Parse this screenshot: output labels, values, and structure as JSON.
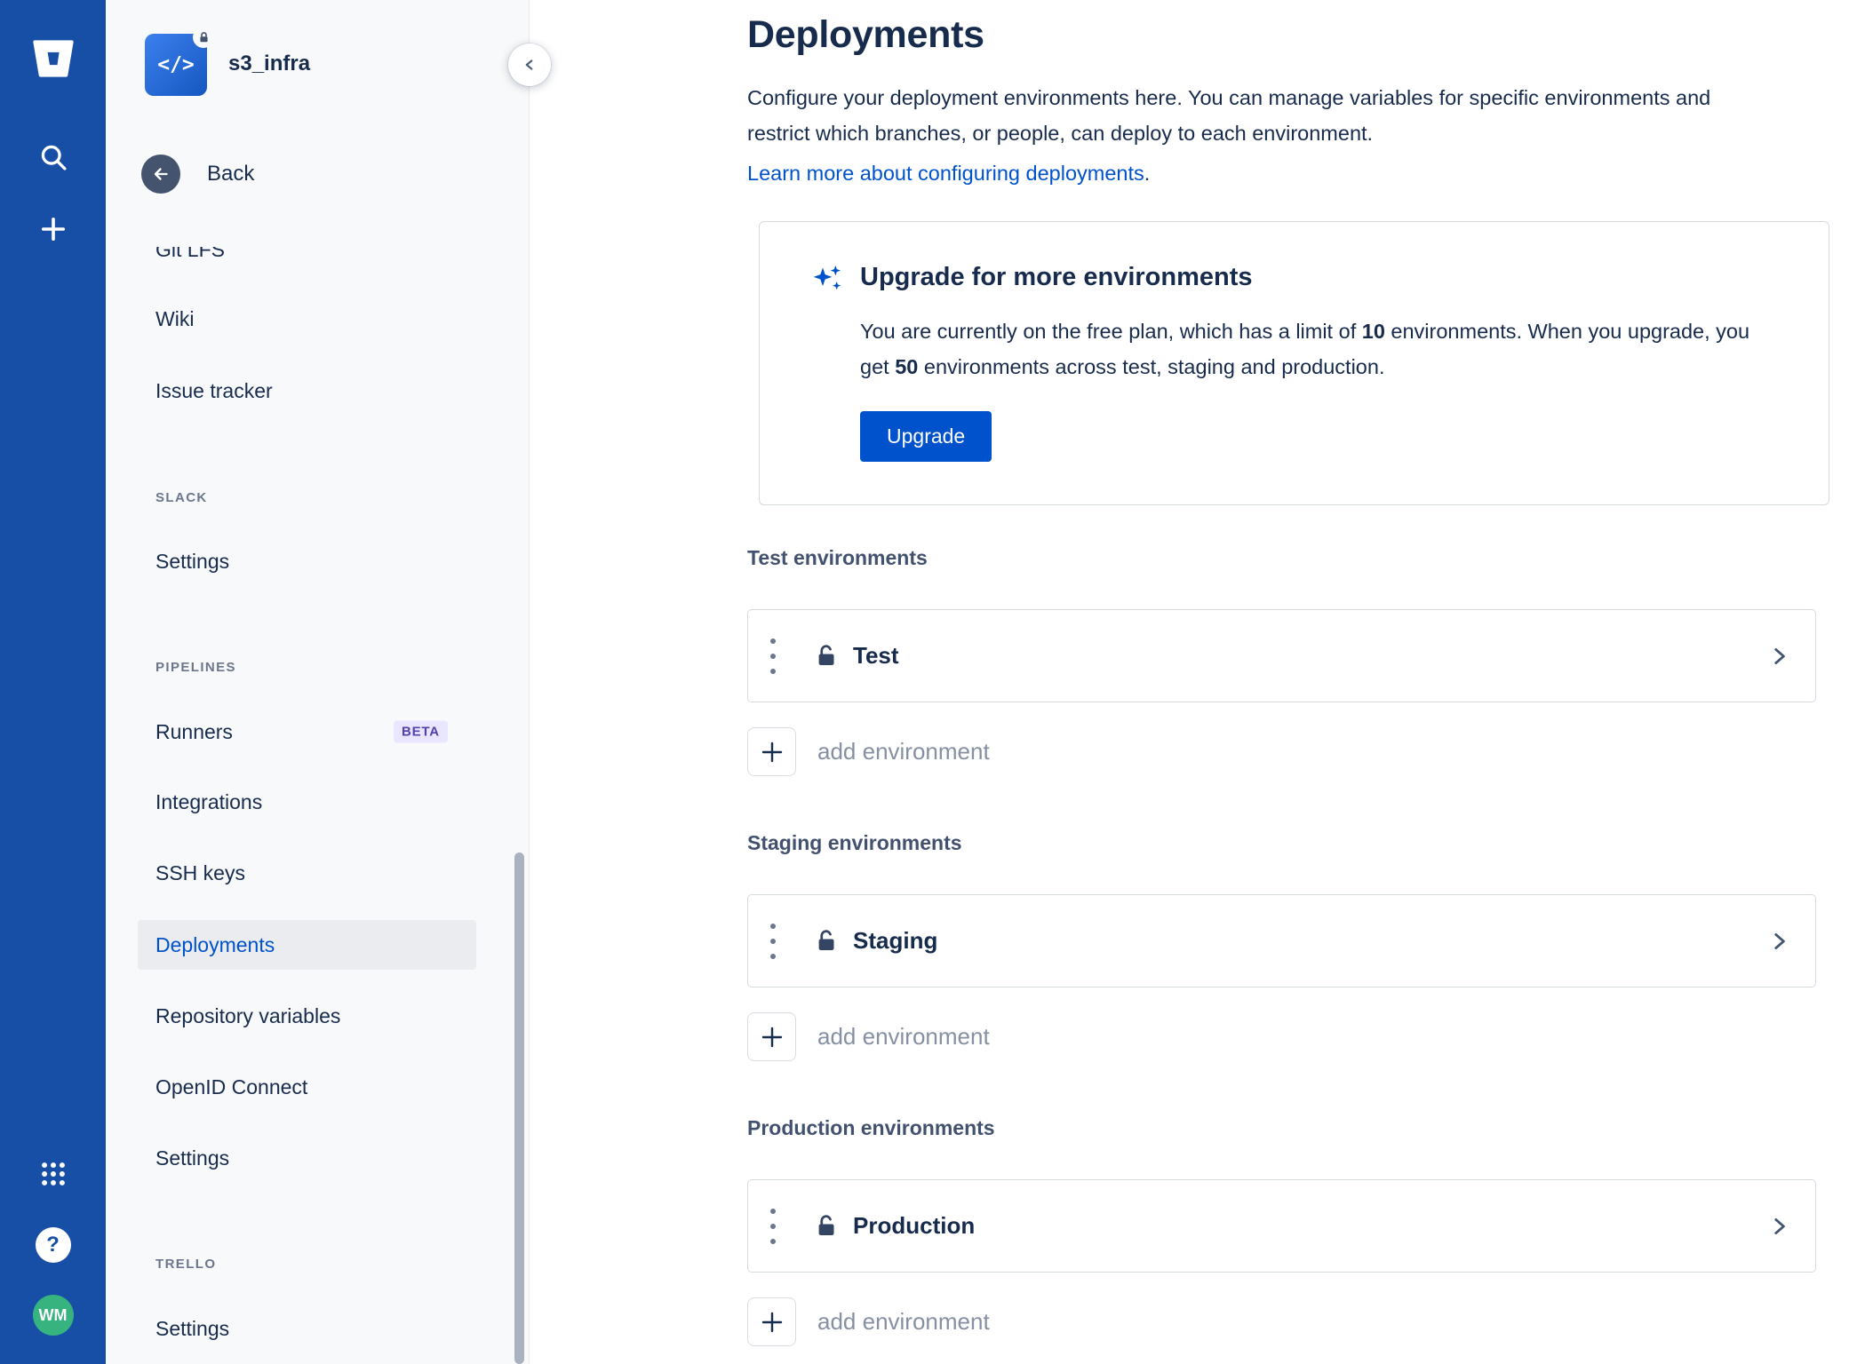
{
  "app_bar": {
    "logo_name": "Bitbucket",
    "help_glyph": "?",
    "avatar_initials": "WM"
  },
  "sidebar": {
    "repo_name": "s3_infra",
    "back_label": "Back",
    "groups": [
      {
        "header": null,
        "items": [
          {
            "label": "Git LFS"
          },
          {
            "label": "Wiki"
          },
          {
            "label": "Issue tracker"
          }
        ]
      },
      {
        "header": "SLACK",
        "items": [
          {
            "label": "Settings"
          }
        ]
      },
      {
        "header": "PIPELINES",
        "items": [
          {
            "label": "Runners",
            "badge": "BETA"
          },
          {
            "label": "Integrations"
          },
          {
            "label": "SSH keys"
          },
          {
            "label": "Deployments",
            "selected": true
          },
          {
            "label": "Repository variables"
          },
          {
            "label": "OpenID Connect"
          },
          {
            "label": "Settings"
          }
        ]
      },
      {
        "header": "TRELLO",
        "items": [
          {
            "label": "Settings"
          }
        ]
      }
    ]
  },
  "main": {
    "title": "Deployments",
    "description": "Configure your deployment environments here. You can manage variables for specific environments and restrict which branches, or people, can deploy to each environment.",
    "learn_more_link": "Learn more about configuring deployments",
    "learn_more_suffix": ".",
    "upgrade_card": {
      "title": "Upgrade for more environments",
      "body_parts": {
        "p1": "You are currently on the free plan, which has a limit of ",
        "b1": "10",
        "p2": " environments. When you upgrade, you get ",
        "b2": "50",
        "p3": " environments across test, staging and production."
      },
      "button_label": "Upgrade"
    },
    "sections": [
      {
        "label": "Test environments",
        "environment": "Test",
        "add_label": "add environment"
      },
      {
        "label": "Staging environments",
        "environment": "Staging",
        "add_label": "add environment"
      },
      {
        "label": "Production environments",
        "environment": "Production",
        "add_label": "add environment"
      }
    ]
  },
  "colors": {
    "app_bar_blue": "#174EA6",
    "accent_blue": "#0052CC",
    "selected_nav_bg": "#EBECF0",
    "beta_badge_bg": "#EAE6FF",
    "beta_badge_text": "#5243AA",
    "avatar_green": "#36B37E",
    "card_border": "#D5DAE1",
    "muted_text": "#8590A2"
  }
}
